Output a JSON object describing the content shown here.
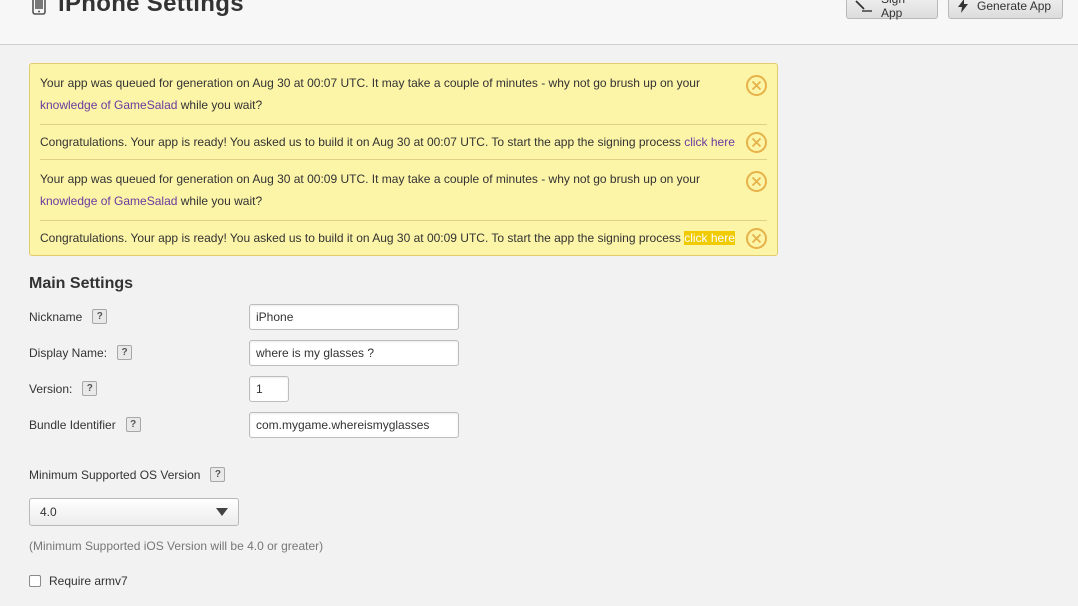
{
  "header": {
    "title": "iPhone Settings",
    "sign_button": "Sign App",
    "generate_button": "Generate App"
  },
  "notices": [
    {
      "text_before": "Your app was queued for generation on Aug 30 at 00:07 UTC. It may take a couple of minutes - why not go brush up on your ",
      "link": "knowledge of GameSalad",
      "text_after": " while you wait?"
    },
    {
      "text_before": "Congratulations. Your app is ready! You asked us to build it on Aug 30 at 00:07 UTC. To start the app the signing process ",
      "link": "click here",
      "text_after": ""
    },
    {
      "text_before": "Your app was queued for generation on Aug 30 at 00:09 UTC. It may take a couple of minutes - why not go brush up on your ",
      "link": "knowledge of GameSalad",
      "text_after": " while you wait?"
    },
    {
      "text_before": "Congratulations. Your app is ready! You asked us to build it on Aug 30 at 00:09 UTC. To start the app the signing process ",
      "link": "click here",
      "text_after": ""
    }
  ],
  "main_settings": {
    "title": "Main Settings",
    "fields": [
      {
        "label": "Nickname",
        "value": "iPhone"
      },
      {
        "label": "Display Name:",
        "value": "where is my glasses ?"
      },
      {
        "label": "Version:",
        "value": "1"
      },
      {
        "label": "Bundle Identifier",
        "value": "com.mygame.whereismyglasses"
      }
    ],
    "min_os_label": "Minimum Supported OS Version",
    "min_os_selected": "4.0",
    "min_os_hint": "(Minimum Supported iOS Version will be 4.0 or greater)",
    "armv7_label": "Require armv7",
    "help_glyph": "?"
  },
  "colors": {
    "notice_bg": "#fcf4a7",
    "notice_border": "#e2cd6e",
    "link": "#6a3aa0",
    "highlight": "#f0cb00",
    "close_icon": "#e6b24a"
  }
}
